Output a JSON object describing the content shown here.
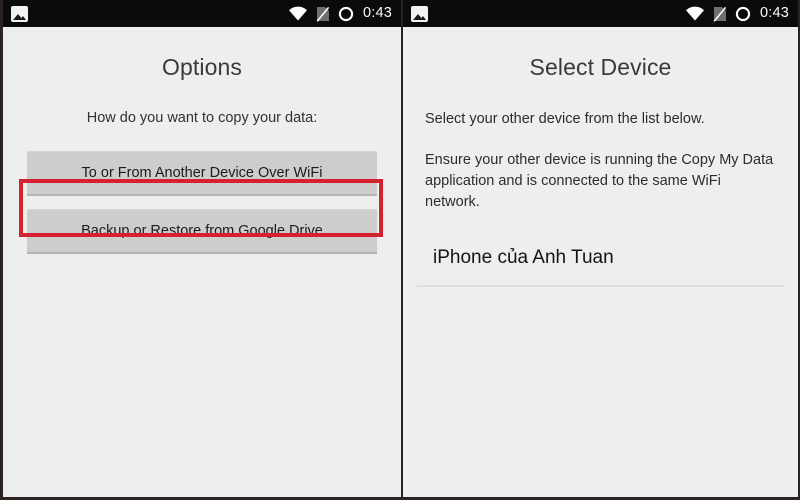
{
  "statusbar": {
    "notification_icon": "photo-icon",
    "wifi_icon": "wifi-icon",
    "sim_icon": "sim-card-off-icon",
    "ring_icon": "circle-ring-icon",
    "time": "0:43"
  },
  "left_panel": {
    "title": "Options",
    "prompt": "How do you want to copy your data:",
    "buttons": [
      {
        "label": "To or From Another Device Over WiFi",
        "highlighted": true
      },
      {
        "label": "Backup or Restore from Google Drive",
        "highlighted": false
      }
    ],
    "highlight_color": "#d5222f"
  },
  "right_panel": {
    "title": "Select Device",
    "paragraphs": [
      "Select your other device from the list below.",
      "Ensure your other device is running the Copy My Data application and is connected to the same WiFi network."
    ],
    "devices": [
      {
        "name": "iPhone của Anh Tuan"
      }
    ]
  },
  "colors": {
    "screen_background": "#efeeee",
    "button_face": "#cdcdcd",
    "statusbar_background": "#0b0b0b",
    "accent_red": "#d5222f",
    "divider": "#dedede"
  }
}
